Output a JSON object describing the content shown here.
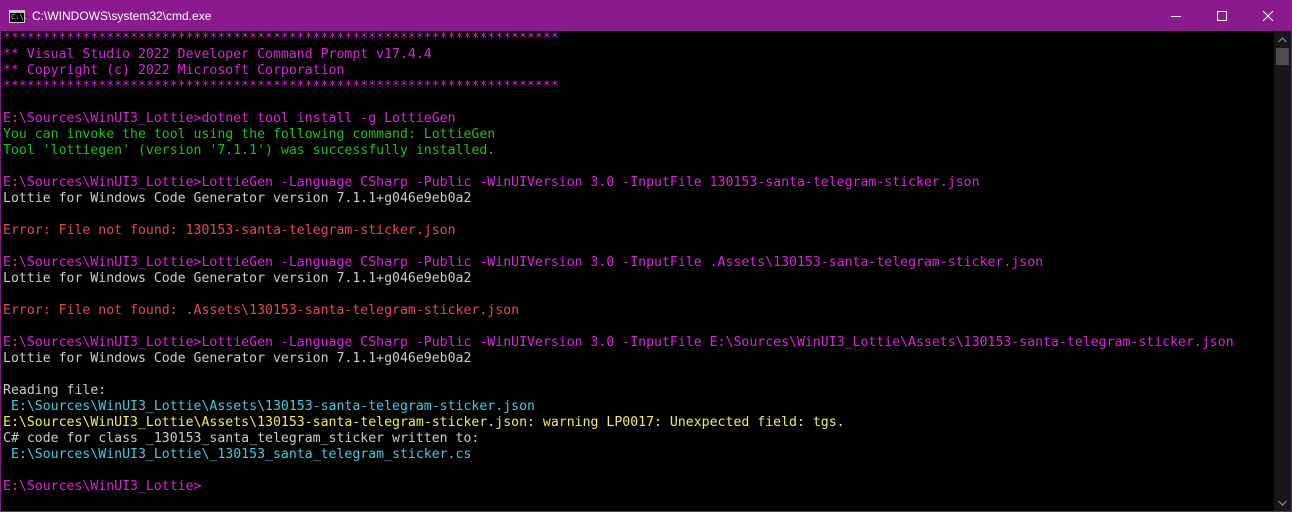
{
  "window": {
    "title": "C:\\WINDOWS\\system32\\cmd.exe",
    "icon_text": "C:\\.",
    "colors": {
      "titlebar": "#8a1a8e",
      "magenta": "#e020e0",
      "white": "#cccccc",
      "green": "#16c60c",
      "red": "#e74856",
      "cyan": "#3ad0e0",
      "yellow": "#f0f050"
    }
  },
  "buttons": {
    "minimize": "minimize-icon",
    "maximize": "maximize-icon",
    "close": "close-icon"
  },
  "console": {
    "lines": [
      {
        "text": "**********************************************************************",
        "color": "magenta"
      },
      {
        "text": "** Visual Studio 2022 Developer Command Prompt v17.4.4",
        "color": "magenta"
      },
      {
        "text": "** Copyright (c) 2022 Microsoft Corporation",
        "color": "magenta"
      },
      {
        "text": "**********************************************************************",
        "color": "magenta"
      },
      {
        "text": "",
        "color": "white"
      },
      {
        "text": "E:\\Sources\\WinUI3_Lottie>dotnet tool install -g LottieGen",
        "color": "magenta"
      },
      {
        "text": "You can invoke the tool using the following command: LottieGen",
        "color": "green"
      },
      {
        "text": "Tool 'lottiegen' (version '7.1.1') was successfully installed.",
        "color": "green"
      },
      {
        "text": "",
        "color": "white"
      },
      {
        "text": "E:\\Sources\\WinUI3_Lottie>LottieGen -Language CSharp -Public -WinUIVersion 3.0 -InputFile 130153-santa-telegram-sticker.json",
        "color": "magenta"
      },
      {
        "text": "Lottie for Windows Code Generator version 7.1.1+g046e9eb0a2",
        "color": "white"
      },
      {
        "text": "",
        "color": "white"
      },
      {
        "text": "Error: File not found: 130153-santa-telegram-sticker.json",
        "color": "red"
      },
      {
        "text": "",
        "color": "white"
      },
      {
        "text": "E:\\Sources\\WinUI3_Lottie>LottieGen -Language CSharp -Public -WinUIVersion 3.0 -InputFile .Assets\\130153-santa-telegram-sticker.json",
        "color": "magenta"
      },
      {
        "text": "Lottie for Windows Code Generator version 7.1.1+g046e9eb0a2",
        "color": "white"
      },
      {
        "text": "",
        "color": "white"
      },
      {
        "text": "Error: File not found: .Assets\\130153-santa-telegram-sticker.json",
        "color": "red"
      },
      {
        "text": "",
        "color": "white"
      },
      {
        "text": "E:\\Sources\\WinUI3_Lottie>LottieGen -Language CSharp -Public -WinUIVersion 3.0 -InputFile E:\\Sources\\WinUI3_Lottie\\Assets\\130153-santa-telegram-sticker.json",
        "color": "magenta"
      },
      {
        "text": "Lottie for Windows Code Generator version 7.1.1+g046e9eb0a2",
        "color": "white"
      },
      {
        "text": "",
        "color": "white"
      },
      {
        "text": "Reading file:",
        "color": "white"
      },
      {
        "text": " E:\\Sources\\WinUI3_Lottie\\Assets\\130153-santa-telegram-sticker.json",
        "color": "cyan"
      },
      {
        "text": "E:\\Sources\\WinUI3_Lottie\\Assets\\130153-santa-telegram-sticker.json: warning LP0017: Unexpected field: tgs.",
        "color": "yellow"
      },
      {
        "text": "C# code for class _130153_santa_telegram_sticker written to:",
        "color": "white"
      },
      {
        "text": " E:\\Sources\\WinUI3_Lottie\\_130153_santa_telegram_sticker.cs",
        "color": "cyan"
      },
      {
        "text": "",
        "color": "white"
      },
      {
        "text": "E:\\Sources\\WinUI3_Lottie>",
        "color": "magenta"
      }
    ]
  }
}
